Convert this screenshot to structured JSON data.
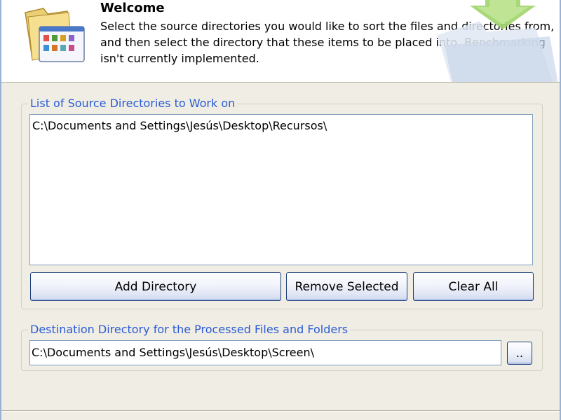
{
  "header": {
    "title": "Welcome",
    "description": "Select the source directories you would like to sort the files and directories from, and then select the directory that these items to be placed into. Benchmarking isn't currently implemented.",
    "icon": "folder-icon",
    "watermark_icon": "folder-download-icon"
  },
  "source": {
    "caption": "List of Source Directories to Work on",
    "items": [
      "C:\\Documents and Settings\\Jesús\\Desktop\\Recursos\\"
    ],
    "add_label": "Add Directory",
    "remove_label": "Remove Selected",
    "clear_label": "Clear All"
  },
  "destination": {
    "caption": "Destination Directory for the Processed Files and Folders",
    "value": "C:\\Documents and Settings\\Jesús\\Desktop\\Screen\\",
    "browse_label": ".."
  },
  "colors": {
    "caption": "#2a5bd7",
    "header_bg": "#ffffff",
    "dialog_bg": "#efede4",
    "accent_green": "#8cc63f"
  }
}
